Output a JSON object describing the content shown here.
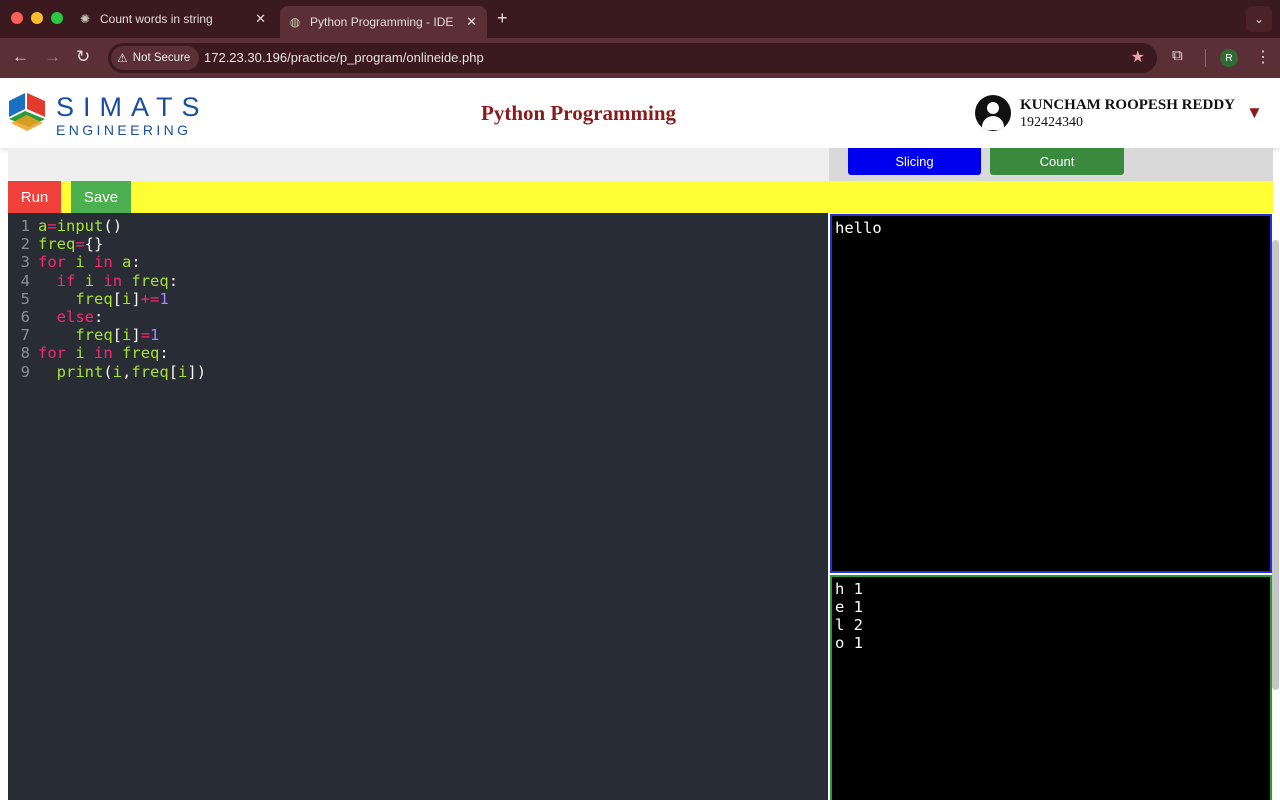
{
  "browser": {
    "tabs": [
      {
        "title": "Count words in string",
        "icon": "openai-icon",
        "active": false
      },
      {
        "title": "Python Programming - IDE",
        "icon": "globe-icon",
        "active": true
      }
    ],
    "security_label": "Not Secure",
    "url": "172.23.30.196/practice/p_program/onlineide.php",
    "profile_initial": "R",
    "colors": {
      "tab_bar": "#3a1a1f",
      "toolbar": "#5a2f35"
    }
  },
  "header": {
    "logo_line1": "SIMATS",
    "logo_line2": "ENGINEERING",
    "title": "Python Programming",
    "user_name": "KUNCHAM ROOPESH REDDY",
    "user_id": "192424340",
    "menu_icon": "triangle-down-icon"
  },
  "toolbar": {
    "slicing_label": "Slicing",
    "count_label": "Count",
    "run_label": "Run",
    "save_label": "Save",
    "colors": {
      "run": "#f0403a",
      "save": "#4caf50",
      "bar": "#ffff33",
      "slicing": "#0000ee",
      "count": "#3a8a3e"
    }
  },
  "editor": {
    "lines": [
      {
        "n": "1",
        "tokens": [
          [
            "v",
            "a"
          ],
          [
            "o",
            "="
          ],
          [
            "v",
            "input"
          ],
          [
            "p",
            "()"
          ]
        ]
      },
      {
        "n": "2",
        "tokens": [
          [
            "v",
            "freq"
          ],
          [
            "o",
            "="
          ],
          [
            "p",
            "{}"
          ]
        ]
      },
      {
        "n": "3",
        "tokens": [
          [
            "k",
            "for"
          ],
          [
            "p",
            " "
          ],
          [
            "v",
            "i"
          ],
          [
            "p",
            " "
          ],
          [
            "k",
            "in"
          ],
          [
            "p",
            " "
          ],
          [
            "v",
            "a"
          ],
          [
            "p",
            ":"
          ]
        ]
      },
      {
        "n": "4",
        "tokens": [
          [
            "p",
            "  "
          ],
          [
            "k",
            "if"
          ],
          [
            "p",
            " "
          ],
          [
            "v",
            "i"
          ],
          [
            "p",
            " "
          ],
          [
            "k",
            "in"
          ],
          [
            "p",
            " "
          ],
          [
            "v",
            "freq"
          ],
          [
            "p",
            ":"
          ]
        ]
      },
      {
        "n": "5",
        "tokens": [
          [
            "p",
            "    "
          ],
          [
            "v",
            "freq"
          ],
          [
            "p",
            "["
          ],
          [
            "v",
            "i"
          ],
          [
            "p",
            "]"
          ],
          [
            "o",
            "+="
          ],
          [
            "n",
            "1"
          ]
        ]
      },
      {
        "n": "6",
        "tokens": [
          [
            "p",
            "  "
          ],
          [
            "k",
            "else"
          ],
          [
            "p",
            ":"
          ]
        ]
      },
      {
        "n": "7",
        "tokens": [
          [
            "p",
            "    "
          ],
          [
            "v",
            "freq"
          ],
          [
            "p",
            "["
          ],
          [
            "v",
            "i"
          ],
          [
            "p",
            "]"
          ],
          [
            "o",
            "="
          ],
          [
            "n",
            "1"
          ]
        ]
      },
      {
        "n": "8",
        "tokens": [
          [
            "k",
            "for"
          ],
          [
            "p",
            " "
          ],
          [
            "v",
            "i"
          ],
          [
            "p",
            " "
          ],
          [
            "k",
            "in"
          ],
          [
            "p",
            " "
          ],
          [
            "v",
            "freq"
          ],
          [
            "p",
            ":"
          ]
        ]
      },
      {
        "n": "9",
        "tokens": [
          [
            "p",
            "  "
          ],
          [
            "v",
            "print"
          ],
          [
            "p",
            "("
          ],
          [
            "v",
            "i"
          ],
          [
            "p",
            ","
          ],
          [
            "v",
            "freq"
          ],
          [
            "p",
            "["
          ],
          [
            "v",
            "i"
          ],
          [
            "p",
            "])"
          ]
        ]
      }
    ]
  },
  "input_panel": {
    "text": "hello"
  },
  "output_panel": {
    "lines": [
      "h 1",
      "e 1",
      "l 2",
      "o 1"
    ]
  }
}
